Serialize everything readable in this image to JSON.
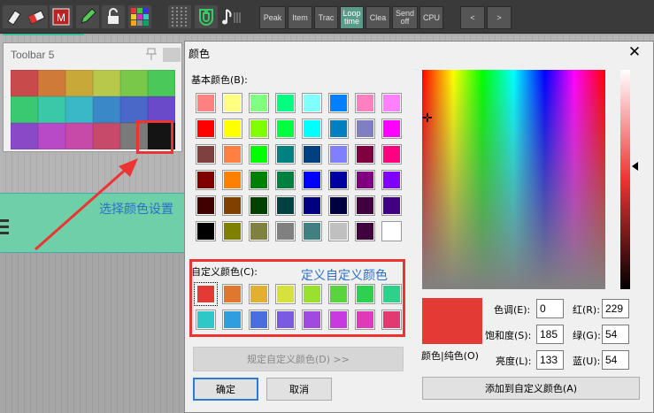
{
  "toolbar": {
    "buttons": [
      "Peak",
      "Item",
      "Trac",
      "Loop time",
      "Clea",
      "Send off",
      "CPU",
      "<",
      ">"
    ],
    "icons": [
      "eraser-icon",
      "eraser-red-icon",
      "m-icon",
      "pencil-icon",
      "lock-icon",
      "palette-icon",
      "grid-icon",
      "magnet-icon",
      "note-icon"
    ]
  },
  "toolbar5": {
    "title": "Toolbar 5",
    "palette": [
      "#c94a4a",
      "#d07a3a",
      "#c8a838",
      "#b8c84a",
      "#7ac84a",
      "#4ac85a",
      "#3ac870",
      "#3ac8a8",
      "#3ab8c8",
      "#3a88c8",
      "#4a68c8",
      "#6a4ac8",
      "#8a4ac8",
      "#b84ac8",
      "#c84aa8",
      "#c84a6a",
      "#7a7a7a",
      "#141414"
    ]
  },
  "annotations": {
    "select_color": "选择颜色设置",
    "define_custom": "定义自定义颜色"
  },
  "dialog": {
    "title": "颜色",
    "basic_label": "基本颜色(B):",
    "custom_label": "自定义颜色(C):",
    "define_button": "规定自定义颜色(D) >>",
    "ok": "确定",
    "cancel": "取消",
    "add_custom": "添加到自定义颜色(A)",
    "color_solid": "颜色|纯色(O)",
    "hue_label": "色调(E):",
    "hue": "0",
    "sat_label": "饱和度(S):",
    "sat": "185",
    "lum_label": "亮度(L):",
    "lum": "133",
    "red_label": "红(R):",
    "red": "229",
    "green_label": "绿(G):",
    "green": "54",
    "blue_label": "蓝(U):",
    "blue": "54",
    "basic_colors": [
      "#ff8080",
      "#ffff80",
      "#80ff80",
      "#00ff80",
      "#80ffff",
      "#0080ff",
      "#ff80c0",
      "#ff80ff",
      "#ff0000",
      "#ffff00",
      "#80ff00",
      "#00ff40",
      "#00ffff",
      "#0080c0",
      "#8080c0",
      "#ff00ff",
      "#804040",
      "#ff8040",
      "#00ff00",
      "#008080",
      "#004080",
      "#8080ff",
      "#800040",
      "#ff0080",
      "#800000",
      "#ff8000",
      "#008000",
      "#008040",
      "#0000ff",
      "#0000a0",
      "#800080",
      "#8000ff",
      "#400000",
      "#804000",
      "#004000",
      "#004040",
      "#000080",
      "#000040",
      "#400040",
      "#400080",
      "#000000",
      "#808000",
      "#808040",
      "#808080",
      "#408080",
      "#c0c0c0",
      "#400040",
      "#ffffff"
    ],
    "custom_colors": [
      "#e33a36",
      "#e0772f",
      "#e0b02e",
      "#d6e03e",
      "#9ae02e",
      "#59d43c",
      "#2ed050",
      "#2ed08a",
      "#2ec8c8",
      "#2e9ee0",
      "#4a6ee0",
      "#7a5ae0",
      "#a04ae0",
      "#c83ae0",
      "#e03ab8",
      "#e03a70"
    ]
  }
}
